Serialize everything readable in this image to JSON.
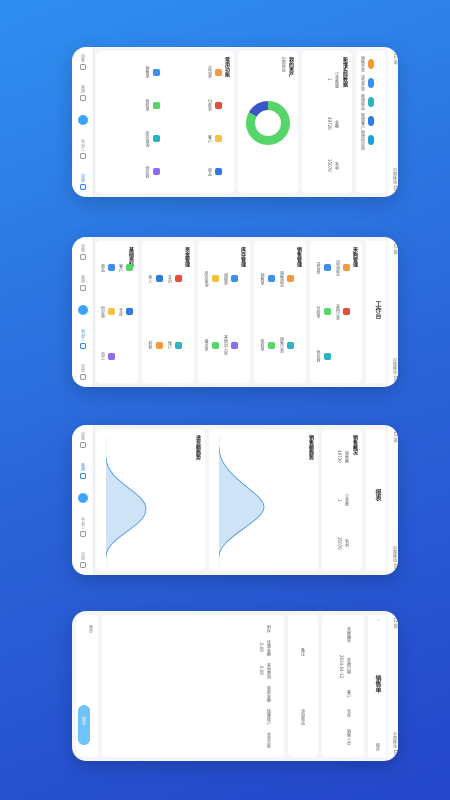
{
  "phone1": {
    "status_time": "12:08",
    "status_right": "中国移动 4G",
    "quick_items": [
      "销售开单",
      "进货开单",
      "新增商品",
      "新增客户",
      "新增供应商"
    ],
    "stats_title": "新增实际数据",
    "stats": [
      {
        "label": "订单数量",
        "value": "1"
      },
      {
        "label": "金额",
        "value": "49720"
      },
      {
        "label": "毛利",
        "value": "35070"
      }
    ],
    "asset_title": "我的资产",
    "asset_value": "288000",
    "shortcut_title": "常用功能",
    "shortcuts": [
      "销售单",
      "进货单",
      "收款单",
      "付款单",
      "库存查询",
      "客户",
      "供应商",
      "商品"
    ],
    "tabs": [
      "首页",
      "工作台",
      "开单",
      "报表",
      "我的"
    ]
  },
  "phone2": {
    "title": "工作台",
    "sections": [
      {
        "name": "采购管理",
        "items": [
          "进货单",
          "进货退货",
          "付款单",
          "采购订单",
          "供应商"
        ]
      },
      {
        "name": "销售管理",
        "items": [
          "销售单",
          "销售退货",
          "收款单",
          "销售订单"
        ]
      },
      {
        "name": "库存管理",
        "items": [
          "库存查询",
          "调拨单",
          "盘点单",
          "其他出入库"
        ]
      },
      {
        "name": "资金管理",
        "items": [
          "收入",
          "支出",
          "转账",
          "账户"
        ]
      },
      {
        "name": "基础资料",
        "items": [
          "商品",
          "客户",
          "供应商",
          "仓库",
          "员工"
        ]
      }
    ],
    "tabs": [
      "首页",
      "工作台",
      "开单",
      "报表",
      "我的"
    ]
  },
  "phone3": {
    "title": "报表",
    "summary_title": "销售概况",
    "summary": [
      {
        "label": "销售额",
        "value": "49720"
      },
      {
        "label": "订单数",
        "value": "1"
      },
      {
        "label": "毛利",
        "value": "35070"
      }
    ],
    "chart1_title": "销售额趋势",
    "chart2_title": "进货额趋势",
    "tabs": [
      "首页",
      "工作台",
      "开单",
      "报表",
      "我的"
    ]
  },
  "phone4": {
    "title": "销售单",
    "save_label": "保存",
    "fields": [
      "单据编号",
      "单据日期",
      "客户",
      "仓库",
      "销售人员",
      "备注",
      "附件",
      "优惠金额",
      "其他费用",
      "收款金额",
      "结算账户",
      "本单欠款"
    ],
    "date_value": "2024-04-12",
    "add_goods": "添加商品",
    "submit_label": "提交",
    "total_label": "合计",
    "total_value": "0.00"
  }
}
